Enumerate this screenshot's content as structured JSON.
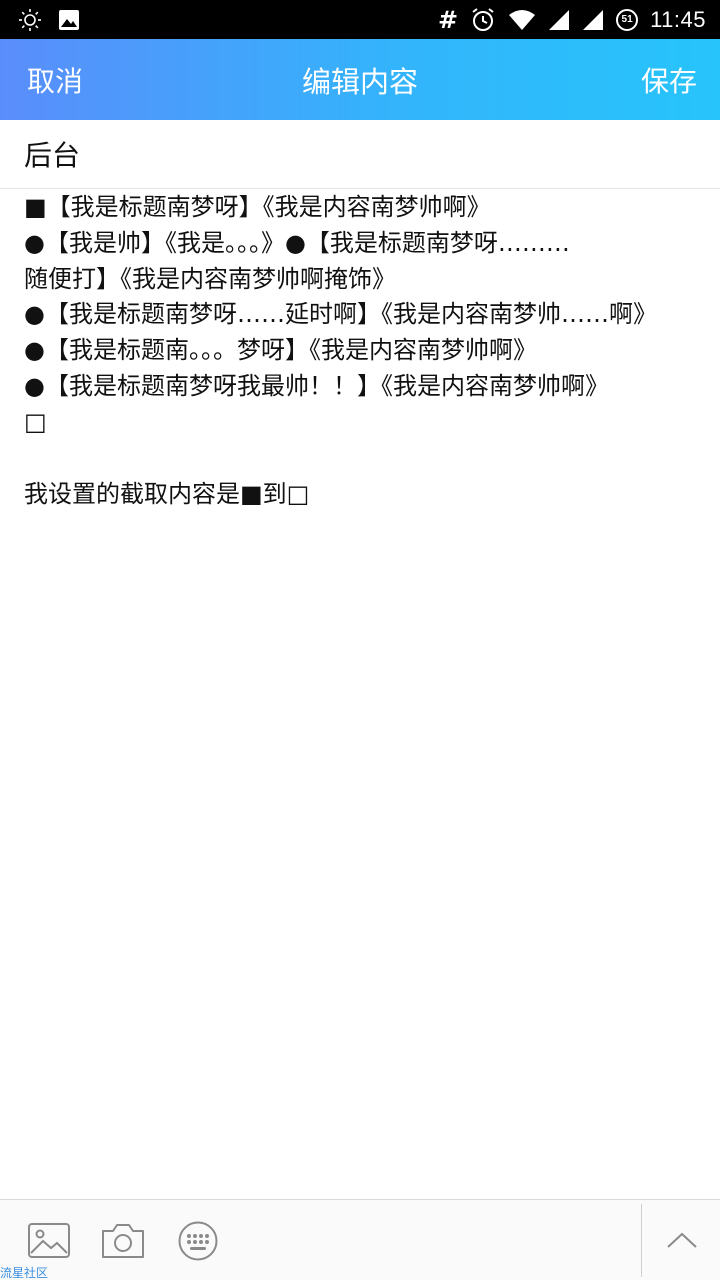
{
  "status_bar": {
    "time": "11:45",
    "hash_symbol": "#",
    "badge": "51",
    "icons": [
      "brightness-icon",
      "image-notification-icon",
      "alarm-icon",
      "wifi-icon",
      "signal-icon",
      "signal-icon-2",
      "battery-saver-icon"
    ]
  },
  "header": {
    "cancel_label": "取消",
    "title": "编辑内容",
    "save_label": "保存",
    "gradient": [
      "#5a8dfb",
      "#27c4fb"
    ]
  },
  "title_field": {
    "value": "后台"
  },
  "content": {
    "lines": [
      "■【我是标题南梦呀】《我是内容南梦帅啊》",
      "●【我是帅】《我是。。。》●【我是标题南梦呀………",
      "随便打】《我是内容南梦帅啊掩饰》",
      "●【我是标题南梦呀……延时啊】《我是内容南梦帅……啊》",
      "●【我是标题南。。。梦呀】《我是内容南梦帅啊》",
      "●【我是标题南梦呀我最帅！！】《我是内容南梦帅啊》",
      "□"
    ],
    "note": "我设置的截取内容是■到□"
  },
  "toolbar": {
    "icons": [
      "image-icon",
      "camera-icon",
      "emoji-keyboard-icon",
      "chevron-up-icon"
    ]
  },
  "watermark": "流星社区"
}
